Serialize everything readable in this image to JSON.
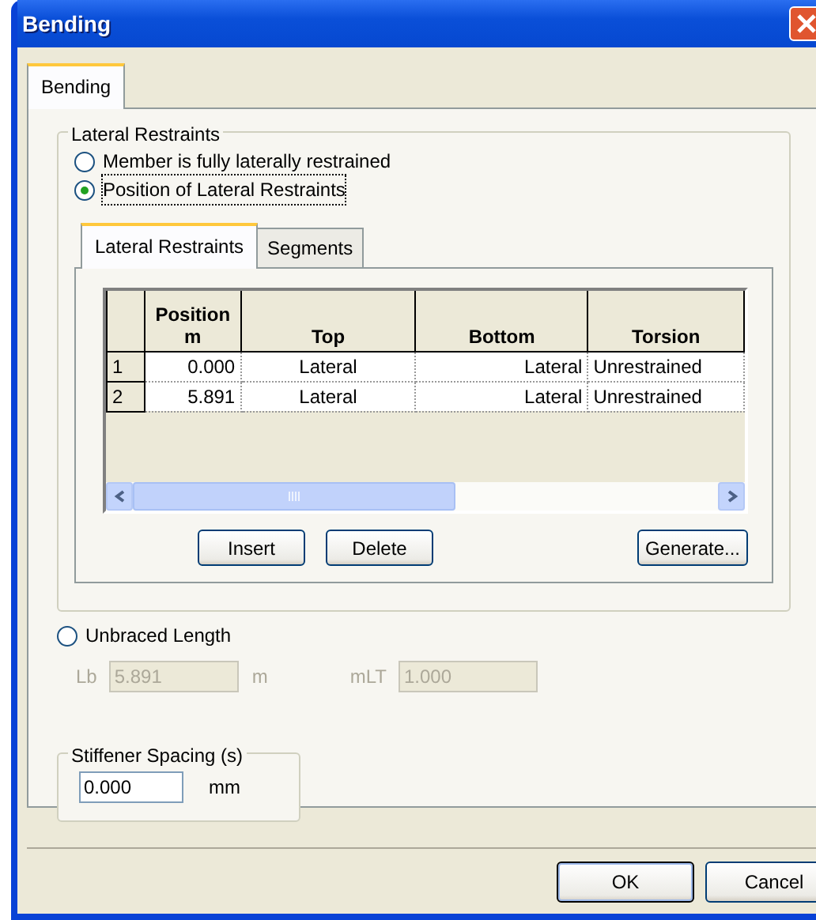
{
  "window": {
    "title": "Bending"
  },
  "tabs": [
    {
      "label": "Bending",
      "selected": true
    }
  ],
  "lateral_restraints": {
    "title": "Lateral Restraints",
    "options": [
      {
        "label": "Member is fully laterally restrained",
        "checked": false,
        "focused": false
      },
      {
        "label": "Position of Lateral Restraints",
        "checked": true,
        "focused": true
      }
    ],
    "inner_tabs": [
      {
        "label": "Lateral Restraints",
        "selected": true
      },
      {
        "label": "Segments",
        "selected": false
      }
    ],
    "table": {
      "columns": [
        "",
        "Position m",
        "Top",
        "Bottom",
        "Torsion"
      ],
      "rows": [
        [
          "1",
          "0.000",
          "Lateral",
          "Lateral",
          "Unrestrained"
        ],
        [
          "2",
          "5.891",
          "Lateral",
          "Lateral",
          "Unrestrained"
        ]
      ]
    },
    "buttons": [
      "Insert",
      "Delete",
      "Generate..."
    ]
  },
  "unbraced": {
    "label": "Unbraced Length",
    "checked": false,
    "fields": [
      {
        "label": "Lb",
        "value": "5.891",
        "unit": "m",
        "disabled": true
      },
      {
        "label": "mLT",
        "value": "1.000",
        "disabled": true
      }
    ]
  },
  "stiffener": {
    "title": "Stiffener Spacing (s)",
    "value": "0.000",
    "unit": "mm"
  },
  "buttons": [
    {
      "label": "OK",
      "default": true
    },
    {
      "label": "Cancel",
      "default": false
    }
  ]
}
